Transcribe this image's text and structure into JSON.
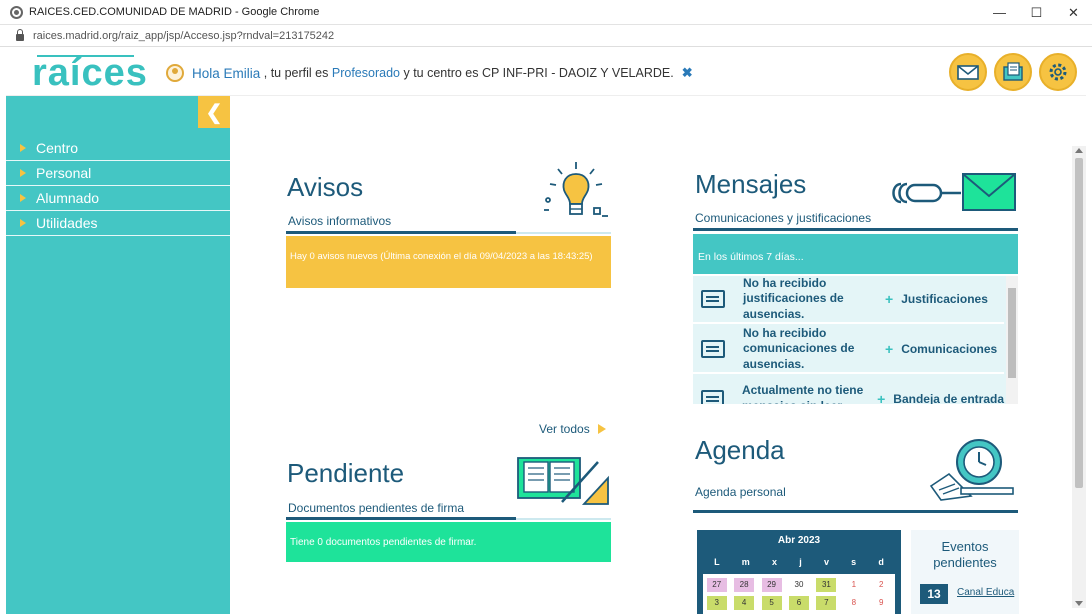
{
  "window": {
    "title": "RAICES.CED.COMUNIDAD DE MADRID - Google Chrome",
    "url": "raices.madrid.org/raiz_app/jsp/Acceso.jsp?rndval=213175242"
  },
  "header": {
    "logo": "raíces",
    "hola": "Hola Emilia",
    "perfil_pre": ", tu perfil es",
    "perfil": "Profesorado",
    "centro_pre": "y tu centro es",
    "centro": "CP INF-PRI - DAOIZ Y VELARDE."
  },
  "sidebar": {
    "items": [
      {
        "label": "Centro"
      },
      {
        "label": "Personal"
      },
      {
        "label": "Alumnado"
      },
      {
        "label": "Utilidades"
      }
    ]
  },
  "avisos": {
    "title": "Avisos",
    "subtitle": "Avisos informativos",
    "message": "Hay 0 avisos nuevos (Última conexión el día 09/04/2023 a las 18:43:25)"
  },
  "pendiente": {
    "ver_todos": "Ver todos",
    "title": "Pendiente",
    "subtitle": "Documentos pendientes de firma",
    "message": "Tiene 0 documentos pendientes de firmar."
  },
  "mensajes": {
    "title": "Mensajes",
    "subtitle": "Comunicaciones y justificaciones",
    "period": "En los últimos 7 días...",
    "rows": [
      {
        "text": "No ha recibido justificaciones de ausencias.",
        "link": "Justificaciones"
      },
      {
        "text": "No ha recibido comunicaciones de ausencias.",
        "link": "Comunicaciones"
      },
      {
        "text": "Actualmente no tiene mensajes sin leer.",
        "link": "Bandeja de entrada"
      }
    ]
  },
  "agenda": {
    "title": "Agenda",
    "subtitle": "Agenda personal",
    "calendar": {
      "month": "Abr 2023",
      "days": [
        "L",
        "m",
        "x",
        "j",
        "v",
        "s",
        "d"
      ],
      "row1": [
        "27",
        "28",
        "29",
        "30",
        "31",
        "1",
        "2"
      ],
      "row2": [
        "3",
        "4",
        "5",
        "6",
        "7",
        "8",
        "9"
      ]
    },
    "eventos_title": "Eventos pendientes",
    "eventos_count": "13",
    "eventos_link": "Canal Educa"
  },
  "colors": {
    "teal": "#44c6c4",
    "yellow": "#f6c342",
    "green": "#1ee39a",
    "navy": "#1d5a7a"
  }
}
